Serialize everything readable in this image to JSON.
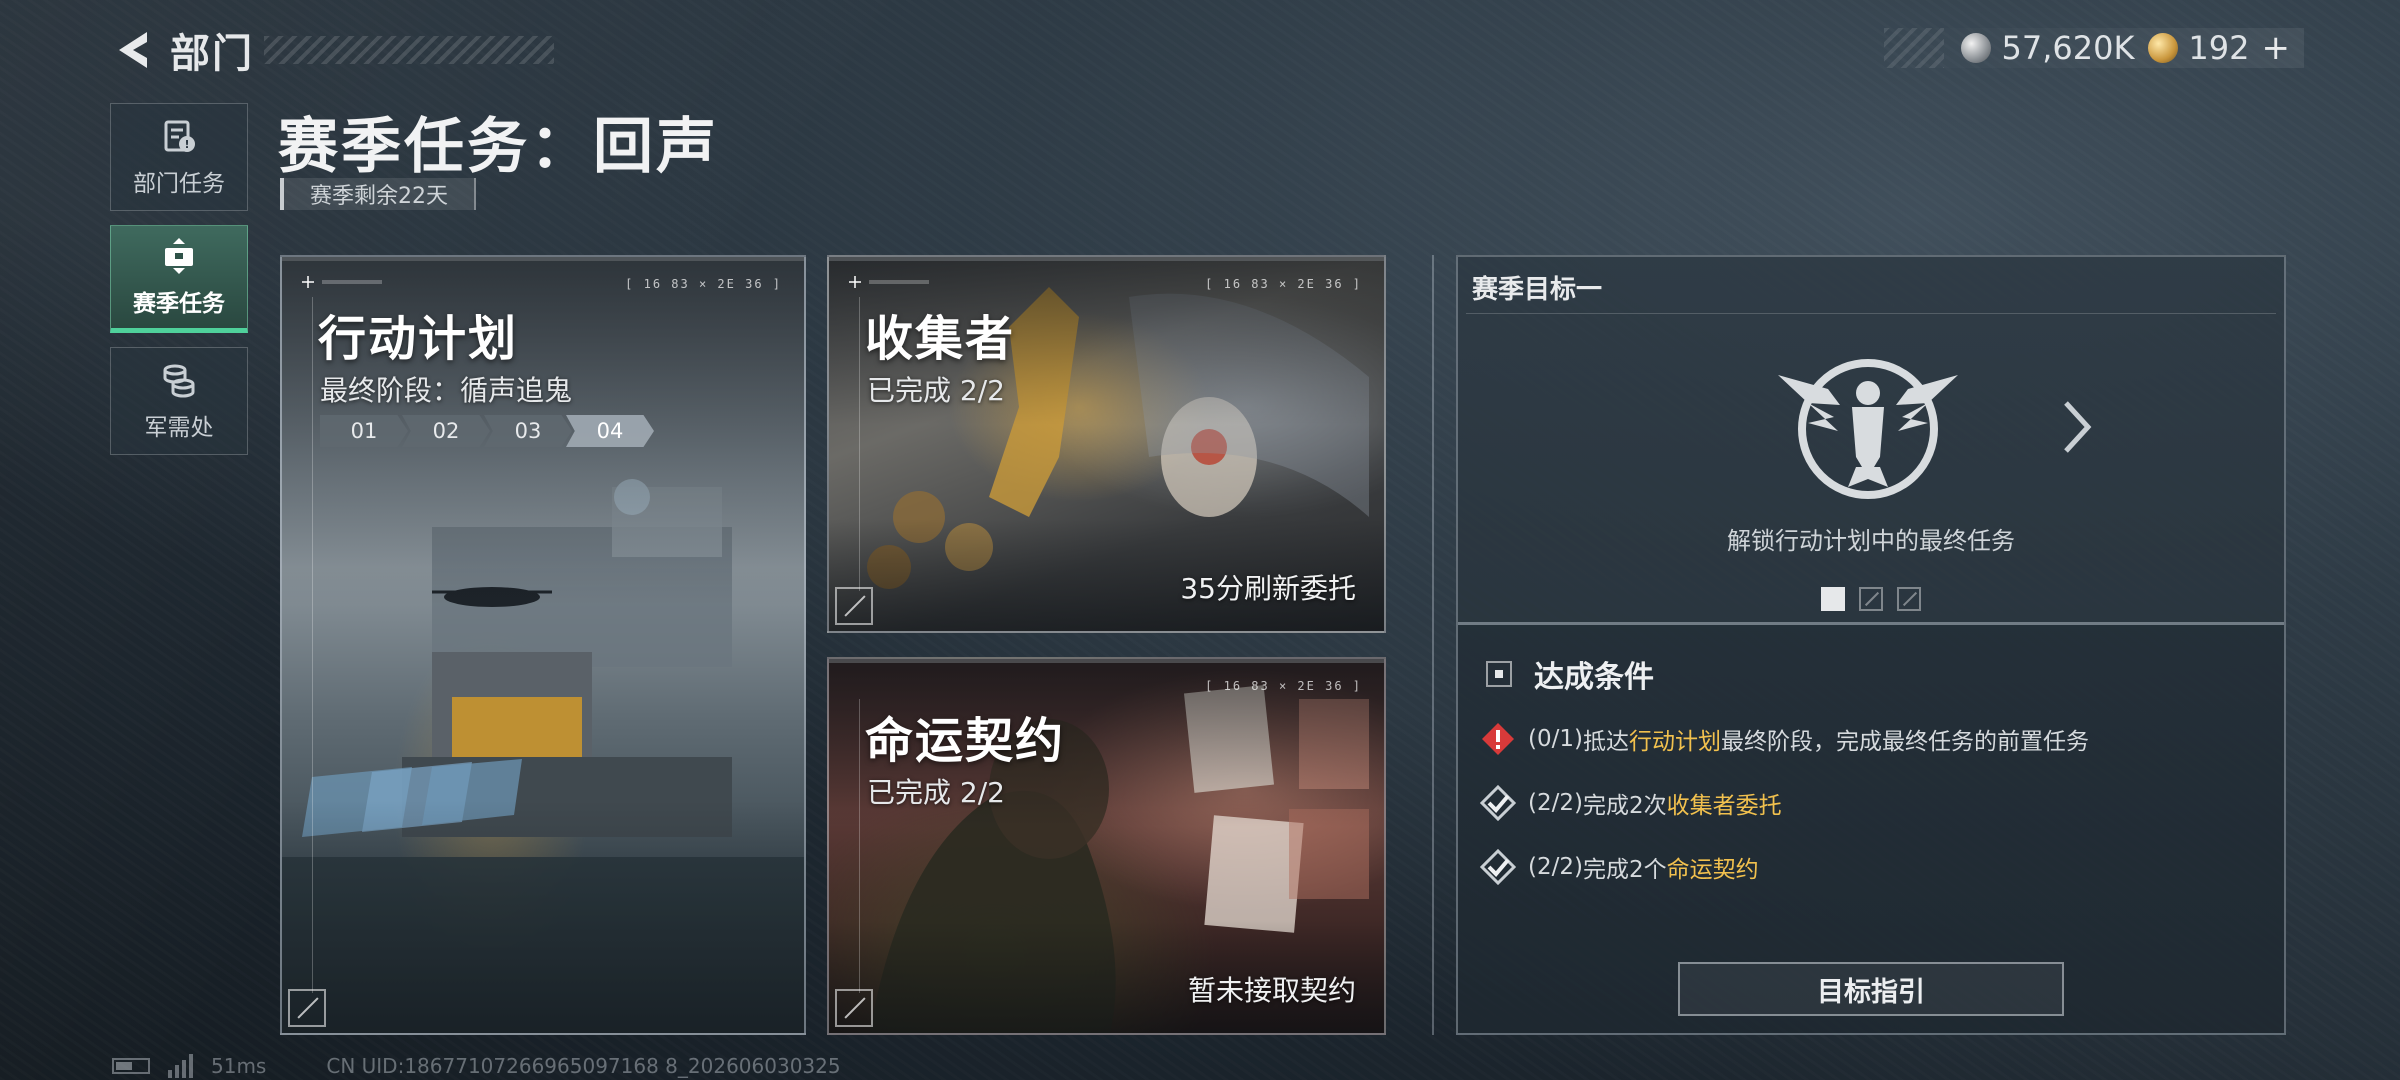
{
  "header": {
    "back_label": "部门",
    "currency": [
      {
        "icon": "silver-coin-icon",
        "value": "57,620K"
      },
      {
        "icon": "gold-coin-icon",
        "value": "192"
      }
    ]
  },
  "sidebar": {
    "items": [
      {
        "label": "部门任务",
        "icon": "department-task-icon",
        "active": false
      },
      {
        "label": "赛季任务",
        "icon": "season-task-icon",
        "active": true
      },
      {
        "label": "军需处",
        "icon": "supply-icon",
        "active": false
      }
    ]
  },
  "page": {
    "title": "赛季任务：回声",
    "remaining": "赛季剩余22天"
  },
  "cards": {
    "plan": {
      "title": "行动计划",
      "subtitle": "最终阶段：循声追鬼",
      "stages": [
        "01",
        "02",
        "03",
        "04"
      ],
      "current_stage": 4,
      "coord": "[ 16 83 × 2E 36 ]"
    },
    "collector": {
      "title": "收集者",
      "subtitle": "已完成 2/2",
      "footer": "35分刷新委托",
      "coord": "[ 16 83 × 2E 36 ]"
    },
    "fate": {
      "title": "命运契约",
      "subtitle": "已完成 2/2",
      "footer": "暂未接取契约",
      "coord": "[ 16 83 × 2E 36 ]"
    }
  },
  "goal": {
    "title": "赛季目标一",
    "description": "解锁行动计划中的最终任务",
    "pages": 3,
    "current_page": 1,
    "conditions_label": "达成条件",
    "conditions": [
      {
        "status": "incomplete",
        "progress": "(0/1)",
        "prefix": "抵达",
        "highlight": "行动计划",
        "suffix": "最终阶段，完成最终任务的前置任务"
      },
      {
        "status": "complete",
        "progress": "(2/2)",
        "prefix": "完成2次",
        "highlight": "收集者委托",
        "suffix": ""
      },
      {
        "status": "complete",
        "progress": "(2/2)",
        "prefix": "完成2个",
        "highlight": "命运契约",
        "suffix": ""
      }
    ],
    "guide_button": "目标指引"
  },
  "footer": {
    "ping": "51ms",
    "uid": "CN UID:18677107266965097168 8_202606030325"
  },
  "colors": {
    "accent_green": "#4fd19b",
    "highlight_gold": "#f2c14e",
    "warning_red": "#d83a3a"
  }
}
